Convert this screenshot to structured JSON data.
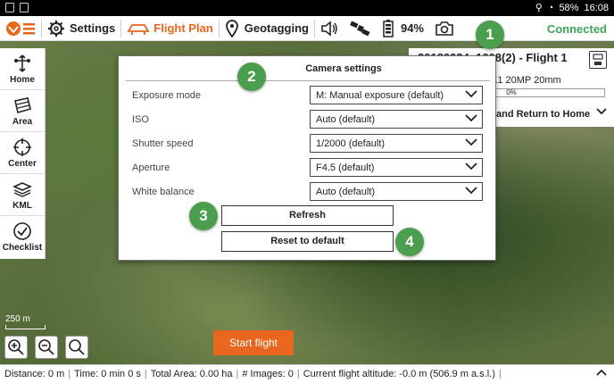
{
  "statusbar": {
    "battery": "58%",
    "time": "16:08"
  },
  "toolbar": {
    "settings": "Settings",
    "flight_plan": "Flight Plan",
    "geotagging": "Geotagging",
    "battery_pct": "94%",
    "connected": "Connected",
    "accent": "#e8661d",
    "connected_color": "#3aa657"
  },
  "sidebar": {
    "items": [
      {
        "label": "Home",
        "icon": "home-icon"
      },
      {
        "label": "Area",
        "icon": "area-icon"
      },
      {
        "label": "Center",
        "icon": "center-icon"
      },
      {
        "label": "KML",
        "icon": "kml-icon"
      },
      {
        "label": "Checklist",
        "icon": "checklist-icon"
      }
    ]
  },
  "right_panel": {
    "title": "20180924_1608(2) - Flight 1",
    "camera": "X1 20MP 20mm",
    "progress": "0%",
    "mode": "and Return to Home"
  },
  "dialog": {
    "title": "Camera settings",
    "rows": [
      {
        "label": "Exposure mode",
        "value": "M: Manual exposure (default)"
      },
      {
        "label": "ISO",
        "value": "Auto (default)"
      },
      {
        "label": "Shutter speed",
        "value": "1/2000 (default)"
      },
      {
        "label": "Aperture",
        "value": "F4.5 (default)"
      },
      {
        "label": "White balance",
        "value": "Auto (default)"
      }
    ],
    "refresh": "Refresh",
    "reset": "Reset to default"
  },
  "badges": [
    "1",
    "2",
    "3",
    "4"
  ],
  "map": {
    "scale": "250 m",
    "start_flight": "Start flight"
  },
  "bottom": {
    "distance": "Distance: 0 m",
    "time": "Time: 0 min 0 s",
    "area": "Total Area: 0.00 ha",
    "images": "# Images: 0",
    "altitude": "Current flight altitude: -0.0 m (506.9 m a.s.l.)"
  }
}
